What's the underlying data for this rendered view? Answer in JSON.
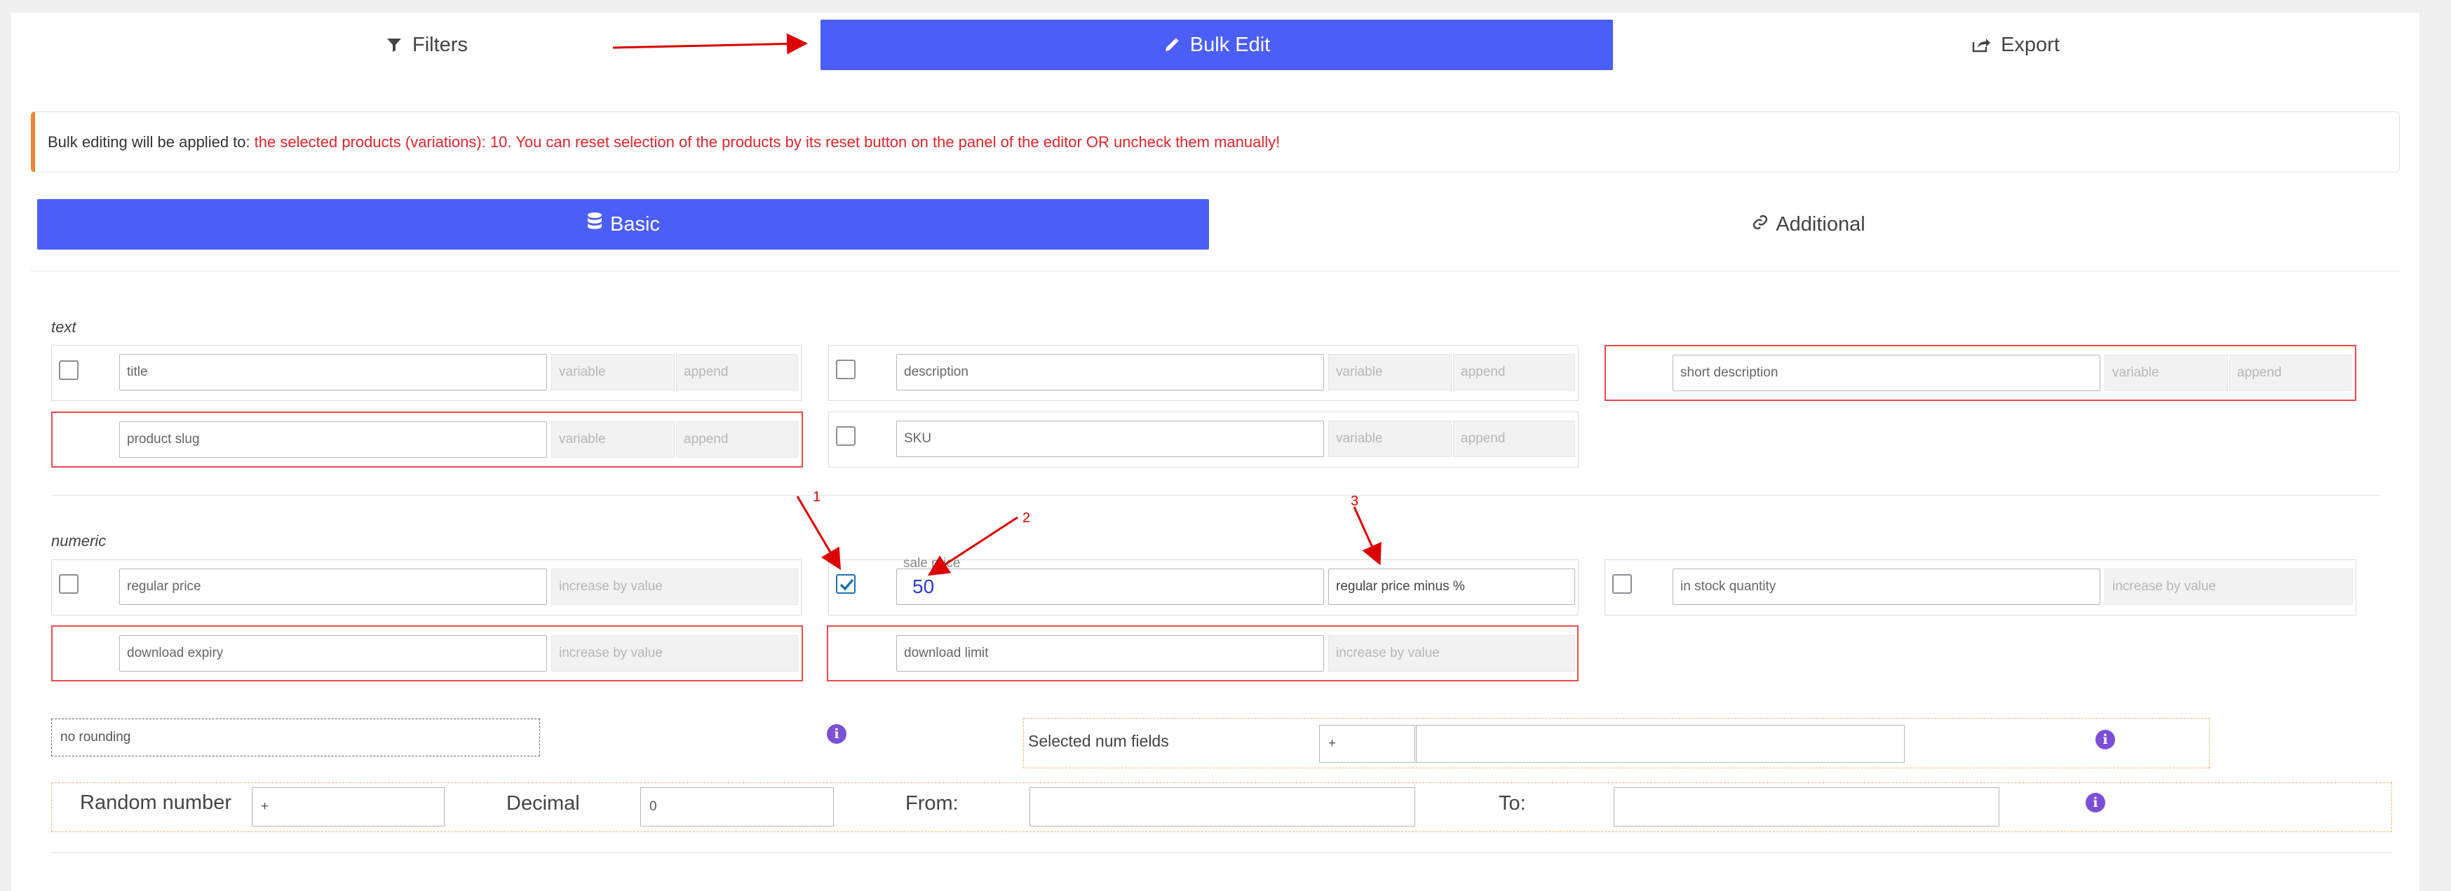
{
  "top_tabs": {
    "filters": "Filters",
    "bulk_edit": "Bulk Edit",
    "export": "Export"
  },
  "notice": {
    "prefix": "Bulk editing will be applied to:",
    "highlight": "the selected products (variations): 10. You can reset selection of the products by its reset button on the panel of the editor OR uncheck them manually!"
  },
  "sub_tabs": {
    "basic": "Basic",
    "additional": "Additional"
  },
  "text_section": {
    "label": "text",
    "fields": [
      {
        "name": "title",
        "mode": "variable",
        "action": "append",
        "checked": false
      },
      {
        "name": "description",
        "mode": "variable",
        "action": "append",
        "checked": false
      },
      {
        "name": "short description",
        "mode": "variable",
        "action": "append",
        "checked": false
      },
      {
        "name": "product slug",
        "mode": "variable",
        "action": "append",
        "checked": false
      },
      {
        "name": "SKU",
        "mode": "variable",
        "action": "append",
        "checked": false
      }
    ]
  },
  "numeric_section": {
    "label": "numeric",
    "fields": [
      {
        "name": "regular price",
        "action": "increase by value",
        "checked": false
      },
      {
        "name": "sale price",
        "value": "50",
        "action": "regular price minus %",
        "checked": true
      },
      {
        "name": "in stock quantity",
        "action": "increase by value",
        "checked": false
      },
      {
        "name": "download expiry",
        "action": "increase by value",
        "checked": false
      },
      {
        "name": "download limit",
        "action": "increase by value",
        "checked": false
      }
    ]
  },
  "rounding": {
    "value": "no rounding"
  },
  "selected_num_fields": {
    "label": "Selected num fields",
    "operator": "+",
    "value": ""
  },
  "random_number": {
    "label": "Random number",
    "operator": "+",
    "decimal_label": "Decimal",
    "decimal_value": "0",
    "from_label": "From:",
    "from_value": "",
    "to_label": "To:",
    "to_value": ""
  },
  "annotations": [
    "1",
    "2",
    "3"
  ],
  "colors": {
    "accent": "#4b5ef7",
    "warning": "#e0252b",
    "notice_border": "#f0852d",
    "info": "#7b4fd6",
    "annotation": "#dd0000"
  },
  "icons": {
    "filters": "filter-icon",
    "bulk_edit": "pencil-icon",
    "export": "export-icon",
    "basic": "database-icon",
    "additional": "link-icon",
    "info": "info-icon"
  }
}
